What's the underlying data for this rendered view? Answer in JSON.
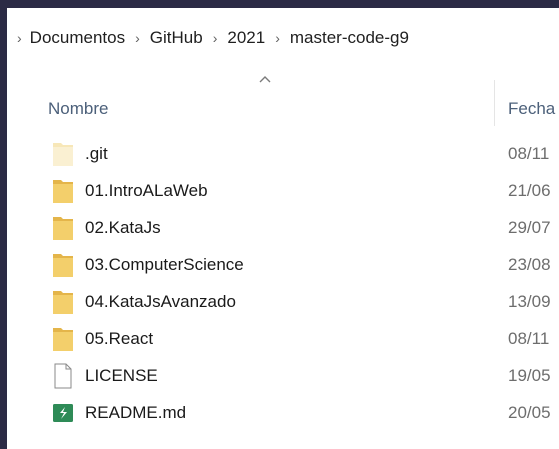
{
  "breadcrumb": {
    "items": [
      "Documentos",
      "GitHub",
      "2021",
      "master-code-g9"
    ]
  },
  "columns": {
    "name": "Nombre",
    "date": "Fecha"
  },
  "files": [
    {
      "name": ".git",
      "date": "08/11",
      "icon": "folder-hidden-icon"
    },
    {
      "name": "01.IntroALaWeb",
      "date": "21/06",
      "icon": "folder-icon"
    },
    {
      "name": "02.KataJs",
      "date": "29/07",
      "icon": "folder-icon"
    },
    {
      "name": "03.ComputerScience",
      "date": "23/08",
      "icon": "folder-icon"
    },
    {
      "name": "04.KataJsAvanzado",
      "date": "13/09",
      "icon": "folder-icon"
    },
    {
      "name": "05.React",
      "date": "08/11",
      "icon": "folder-icon"
    },
    {
      "name": "LICENSE",
      "date": "19/05",
      "icon": "file-icon"
    },
    {
      "name": "README.md",
      "date": "20/05",
      "icon": "markdown-file-icon"
    }
  ],
  "colors": {
    "folder": "#f3cf6b",
    "folder_back": "#e4b54a",
    "markdown": "#2e8b57",
    "header_text": "#4c607a"
  }
}
